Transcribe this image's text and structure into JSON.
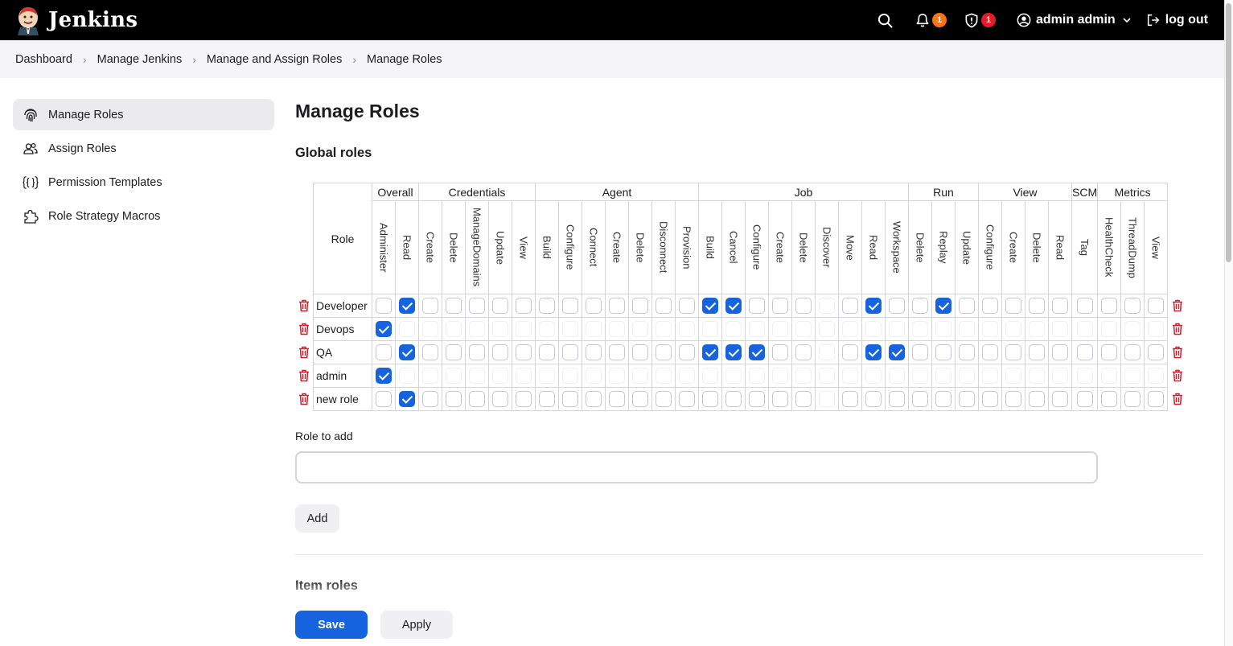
{
  "header": {
    "brand": "Jenkins",
    "notifications_count": "1",
    "security_count": "1",
    "user_name": "admin admin",
    "logout_label": "log out"
  },
  "breadcrumb": [
    "Dashboard",
    "Manage Jenkins",
    "Manage and Assign Roles",
    "Manage Roles"
  ],
  "sidebar": {
    "items": [
      {
        "label": "Manage Roles",
        "icon": "fingerprint-icon",
        "active": true
      },
      {
        "label": "Assign Roles",
        "icon": "users-icon",
        "active": false
      },
      {
        "label": "Permission Templates",
        "icon": "braces-icon",
        "active": false
      },
      {
        "label": "Role Strategy Macros",
        "icon": "puzzle-icon",
        "active": false
      }
    ]
  },
  "main": {
    "title": "Manage Roles",
    "global_roles_title": "Global roles",
    "role_column_header": "Role",
    "role_to_add_label": "Role to add",
    "role_to_add_value": "",
    "add_button": "Add",
    "item_roles_title": "Item roles"
  },
  "permission_groups": [
    {
      "name": "Overall",
      "perms": [
        "Administer",
        "Read"
      ]
    },
    {
      "name": "Credentials",
      "perms": [
        "Create",
        "Delete",
        "ManageDomains",
        "Update",
        "View"
      ]
    },
    {
      "name": "Agent",
      "perms": [
        "Build",
        "Configure",
        "Connect",
        "Create",
        "Delete",
        "Disconnect",
        "Provision"
      ]
    },
    {
      "name": "Job",
      "perms": [
        "Build",
        "Cancel",
        "Configure",
        "Create",
        "Delete",
        "Discover",
        "Move",
        "Read",
        "Workspace"
      ]
    },
    {
      "name": "Run",
      "perms": [
        "Delete",
        "Replay",
        "Update"
      ]
    },
    {
      "name": "View",
      "perms": [
        "Configure",
        "Create",
        "Delete",
        "Read"
      ]
    },
    {
      "name": "SCM",
      "perms": [
        "Tag"
      ]
    },
    {
      "name": "Metrics",
      "perms": [
        "HealthCheck",
        "ThreadDump",
        "View"
      ]
    }
  ],
  "roles": [
    {
      "name": "Developer",
      "checked": [
        1,
        14,
        15,
        21,
        24
      ]
    },
    {
      "name": "Devops",
      "checked": [
        0
      ]
    },
    {
      "name": "QA",
      "checked": [
        1,
        14,
        15,
        16,
        21,
        22
      ]
    },
    {
      "name": "admin",
      "checked": [
        0
      ]
    },
    {
      "name": "new role",
      "checked": [
        1
      ]
    }
  ],
  "footer": {
    "save_label": "Save",
    "apply_label": "Apply"
  },
  "colors": {
    "accent": "#1663e0",
    "delete_icon": "#d11f2b",
    "notification_badge": "#f97316",
    "security_badge": "#e11d2a"
  }
}
